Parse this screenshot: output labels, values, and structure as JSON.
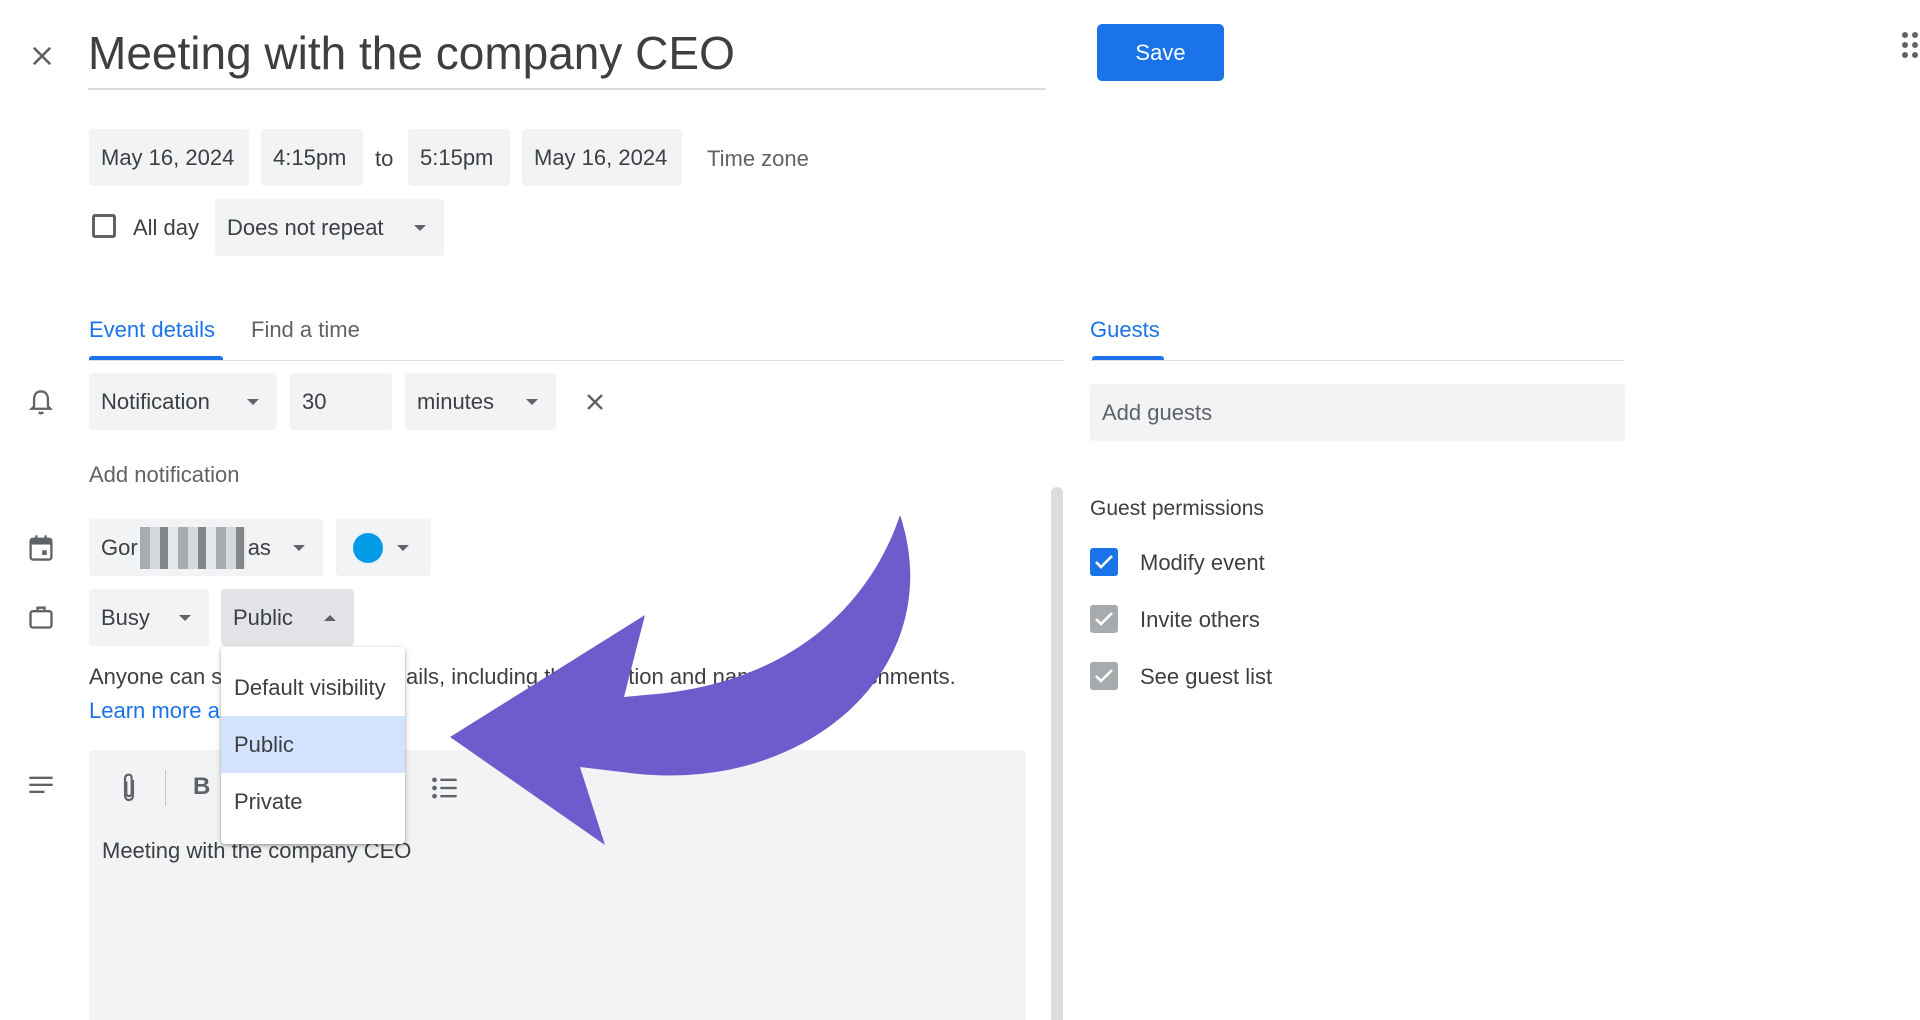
{
  "header": {
    "title": "Meeting with the company CEO",
    "save_label": "Save"
  },
  "datetime": {
    "start_date": "May 16, 2024",
    "start_time": "4:15pm",
    "to_label": "to",
    "end_time": "5:15pm",
    "end_date": "May 16, 2024",
    "timezone_label": "Time zone",
    "allday_label": "All day",
    "repeat_value": "Does not repeat"
  },
  "tabs": {
    "event_details": "Event details",
    "find_time": "Find a time",
    "guests": "Guests"
  },
  "notification": {
    "type": "Notification",
    "amount": "30",
    "unit": "minutes",
    "add_label": "Add notification"
  },
  "calendar": {
    "name_start": "Gor",
    "name_end": "as",
    "color": "#039be5"
  },
  "availability": {
    "status": "Busy",
    "visibility": "Public"
  },
  "visibility_menu": {
    "items": [
      "Default visibility",
      "Public",
      "Private"
    ],
    "selected": "Public"
  },
  "visibility_info": {
    "text_part1": "Anyone can s",
    "text_part2": "ails, including th",
    "text_part3": "ption and nam",
    "text_part4": "ttachments.",
    "learn_more": "Learn more a"
  },
  "description": {
    "bold_label": "B",
    "text": "Meeting with the company CEO"
  },
  "guests": {
    "add_placeholder": "Add guests",
    "permissions_title": "Guest permissions",
    "permissions": [
      {
        "label": "Modify event",
        "checked": true,
        "style": "blue"
      },
      {
        "label": "Invite others",
        "checked": true,
        "style": "gray"
      },
      {
        "label": "See guest list",
        "checked": true,
        "style": "gray"
      }
    ]
  },
  "colors": {
    "accent": "#1a73e8",
    "arrow": "#6f5ccc",
    "menu_selected": "#d3e3fd",
    "field_bg": "#f1f3f4"
  }
}
